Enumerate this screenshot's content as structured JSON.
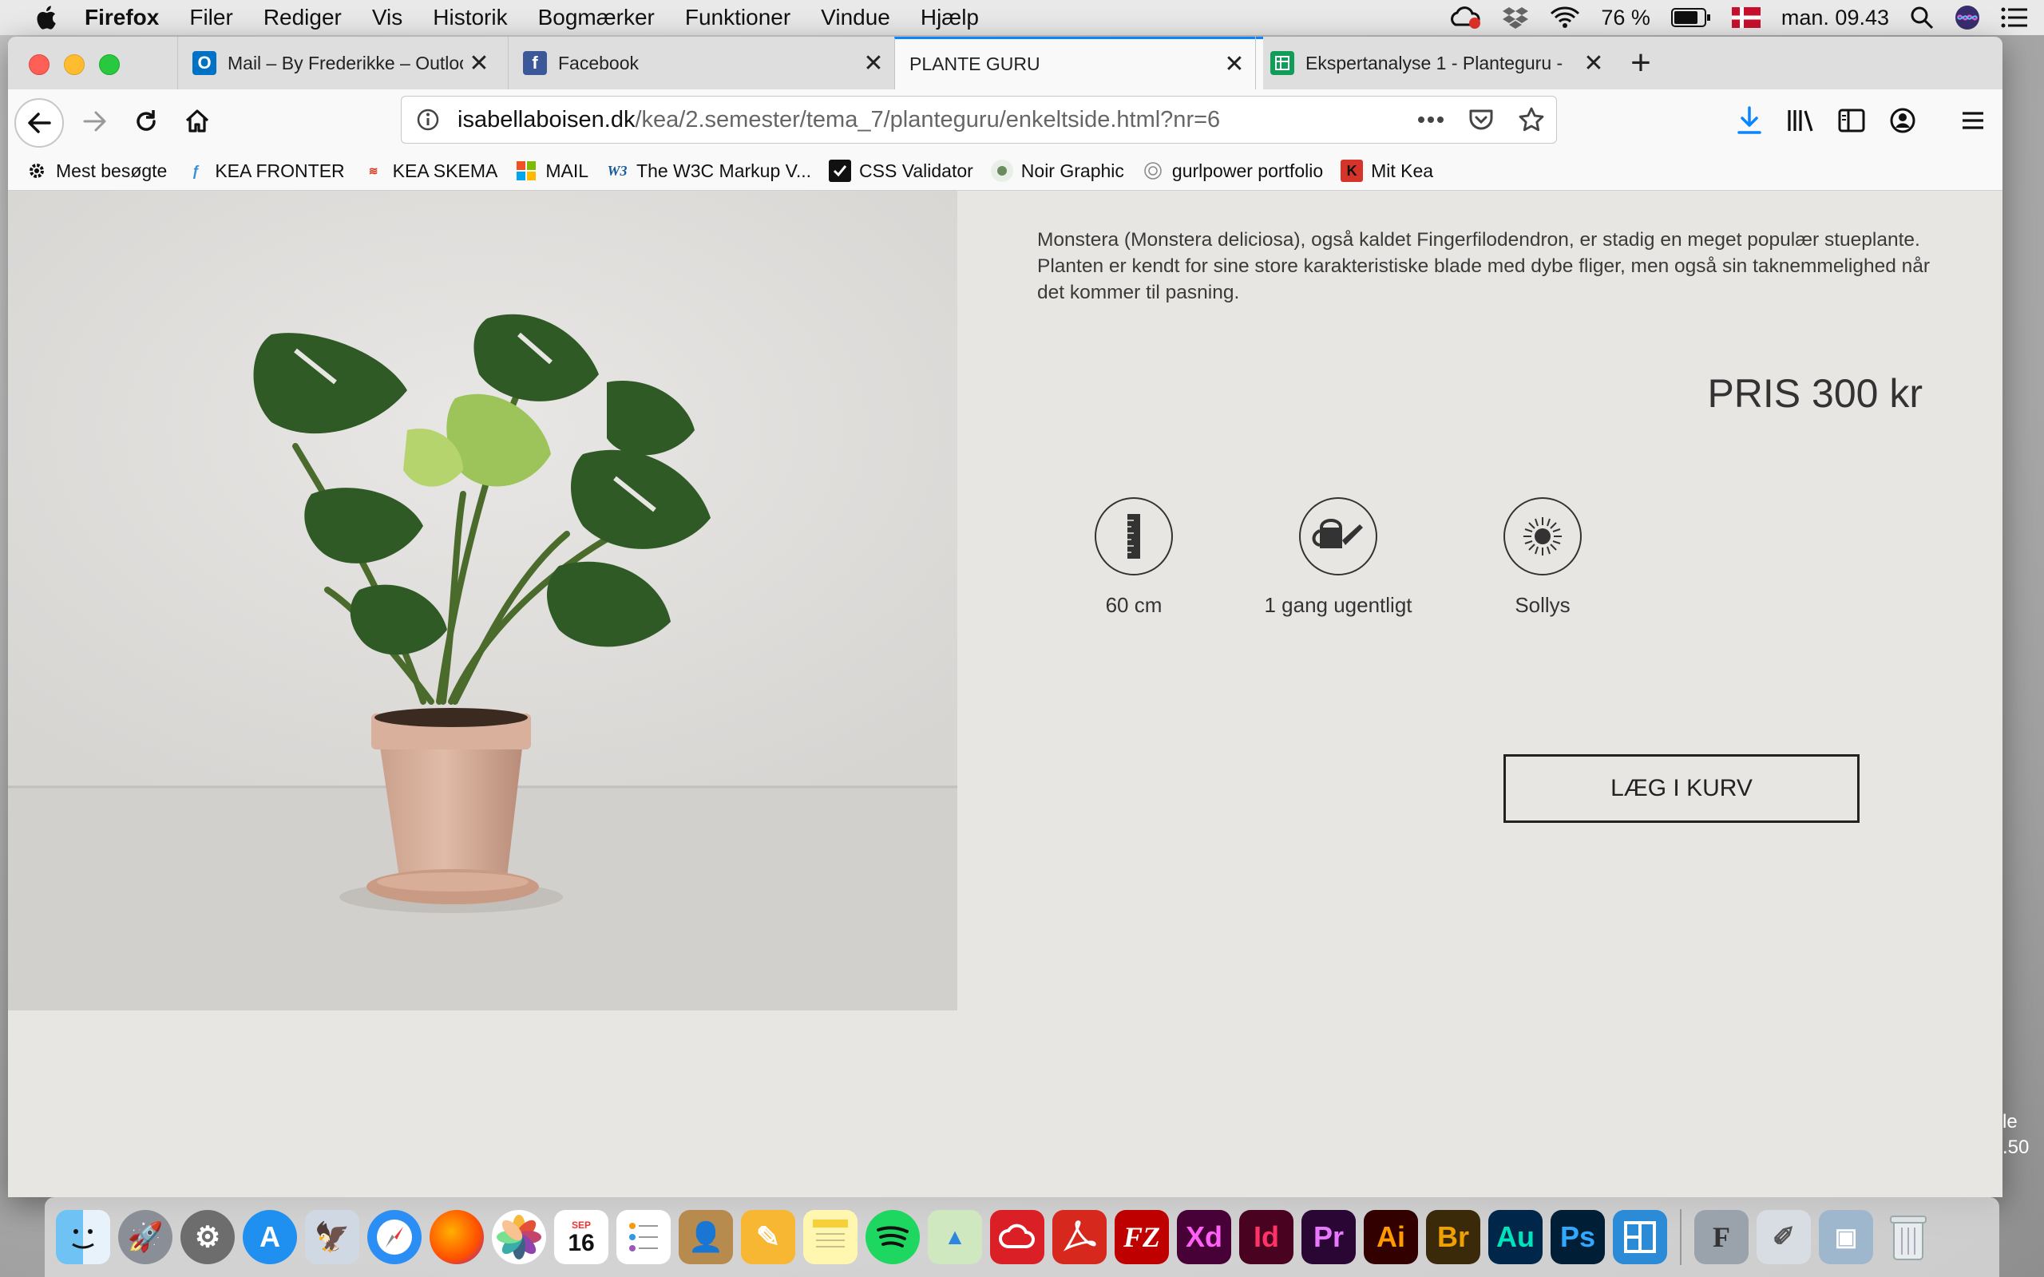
{
  "menubar": {
    "app_name": "Firefox",
    "items": [
      "Filer",
      "Rediger",
      "Vis",
      "Historik",
      "Bogmærker",
      "Funktioner",
      "Vindue",
      "Hjælp"
    ],
    "battery": "76 %",
    "clock": "man. 09.43"
  },
  "tabs": [
    {
      "title": "Mail – By Frederikke – Outlook",
      "favicon": "outlook-icon",
      "color": "#0072c6"
    },
    {
      "title": "Facebook",
      "favicon": "facebook-icon",
      "color": "#3b5998"
    },
    {
      "title": "PLANTE GURU",
      "favicon": "",
      "active": true
    },
    {
      "title": "Ekspertanalyse 1 - Planteguru -",
      "favicon": "sheets-icon",
      "color": "#0f9d58"
    }
  ],
  "url": {
    "host": "isabellaboisen.dk",
    "path": "/kea/2.semester/tema_7/planteguru/enkeltside.html?nr=6"
  },
  "bookmarks": [
    {
      "label": "Mest besøgte",
      "icon": "gear-icon"
    },
    {
      "label": "KEA FRONTER",
      "icon": "fronter-icon"
    },
    {
      "label": "KEA SKEMA",
      "icon": "skema-icon"
    },
    {
      "label": "MAIL",
      "icon": "microsoft-icon"
    },
    {
      "label": "The W3C Markup V...",
      "icon": "w3c-icon"
    },
    {
      "label": "CSS Validator",
      "icon": "css-validator-icon"
    },
    {
      "label": "Noir Graphic",
      "icon": "noir-icon"
    },
    {
      "label": "gurlpower portfolio",
      "icon": "portfolio-icon"
    },
    {
      "label": "Mit Kea",
      "icon": "kea-icon"
    }
  ],
  "product": {
    "description": "Monstera (Monstera deliciosa), også kaldet Fingerfilodendron, er stadig en meget populær stueplante. Planten er kendt for sine store karakteristiske blade med dybe fliger, men også sin taknemmelighed når det kommer til pasning.",
    "price": "PRIS 300 kr",
    "attributes": [
      {
        "label": "60 cm",
        "icon": "ruler-icon"
      },
      {
        "label": "1 gang ugentligt",
        "icon": "watering-can-icon"
      },
      {
        "label": "Sollys",
        "icon": "sun-icon"
      }
    ],
    "cart_label": "LÆG I KURV"
  },
  "dock": {
    "calendar_month": "SEP",
    "calendar_day": "16",
    "apps": [
      "Finder",
      "Launchpad",
      "System Preferences",
      "App Store",
      "Preview",
      "Safari",
      "Firefox",
      "Photos",
      "Calendar",
      "Reminders",
      "Contacts",
      "Pages",
      "Notes",
      "Spotify",
      "Maps",
      "Creative Cloud",
      "Acrobat",
      "FileZilla",
      "Xd",
      "Id",
      "Pr",
      "Ai",
      "Br",
      "Au",
      "Ps",
      "Sketch",
      "Font Book",
      "Pixelmator",
      "Image Capture",
      "Trash"
    ]
  },
  "desktop_fragment": [
    "le",
    ".50"
  ]
}
